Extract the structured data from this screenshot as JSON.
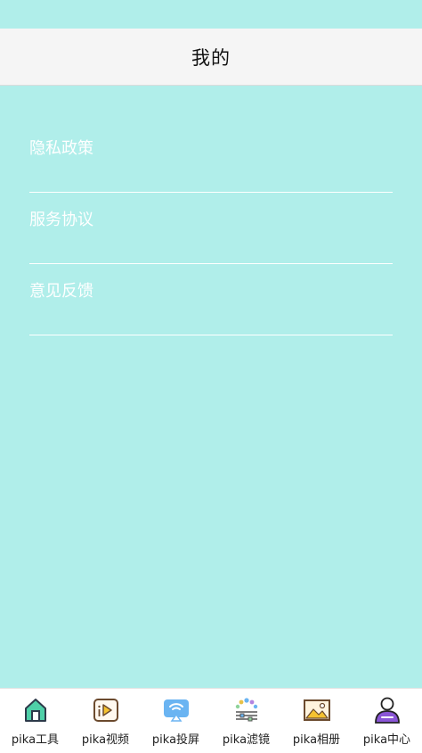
{
  "header": {
    "title": "我的"
  },
  "menu": {
    "items": [
      {
        "label": "隐私政策"
      },
      {
        "label": "服务协议"
      },
      {
        "label": "意见反馈"
      }
    ]
  },
  "tabbar": {
    "tabs": [
      {
        "label": "pika工具",
        "icon": "home-icon"
      },
      {
        "label": "pika视频",
        "icon": "video-icon"
      },
      {
        "label": "pika投屏",
        "icon": "cast-icon"
      },
      {
        "label": "pika滤镜",
        "icon": "filter-icon"
      },
      {
        "label": "pika相册",
        "icon": "album-icon"
      },
      {
        "label": "pika中心",
        "icon": "user-icon"
      }
    ]
  },
  "colors": {
    "background": "#b0eeea",
    "header": "#f5f5f5",
    "divider": "#ffffff"
  }
}
